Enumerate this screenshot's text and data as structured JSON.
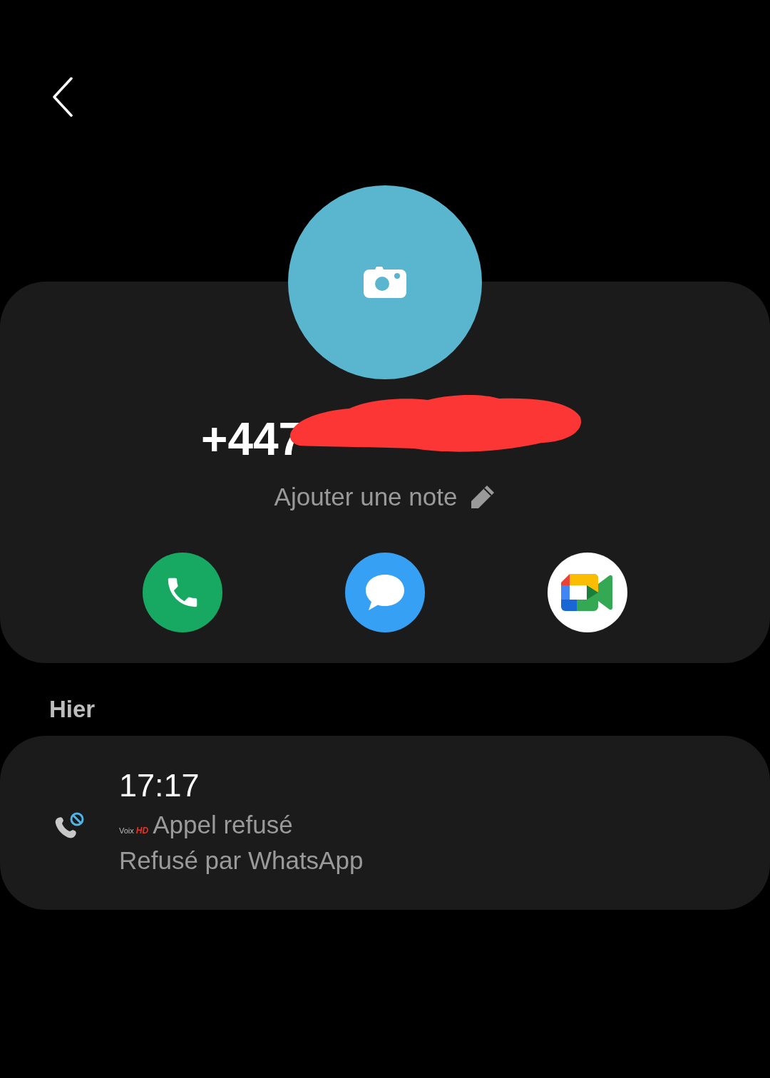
{
  "contact": {
    "number": "+447",
    "redacted": true,
    "note_label": "Ajouter une note"
  },
  "actions": [
    {
      "kind": "call"
    },
    {
      "kind": "message"
    },
    {
      "kind": "video"
    }
  ],
  "history": {
    "date": "Hier",
    "entries": [
      {
        "kind": "rejected",
        "time": "17:17",
        "quality_label": "Voix",
        "quality_badge": "HD",
        "status": "Appel refusé",
        "detail": "Refusé par WhatsApp"
      }
    ]
  }
}
